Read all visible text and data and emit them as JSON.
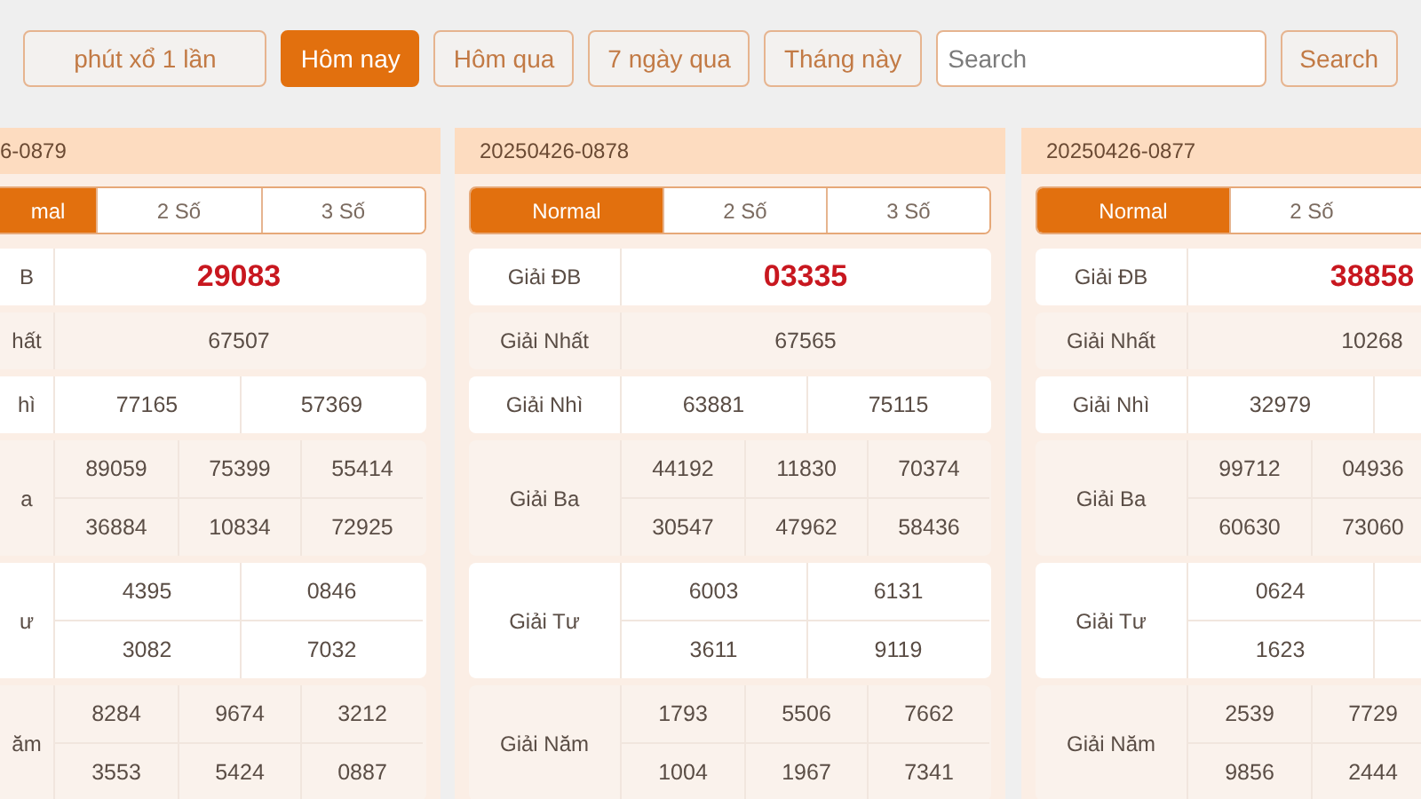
{
  "filters": [
    {
      "label": "phút xổ 1 lần",
      "selected": false
    },
    {
      "label": "Hôm nay",
      "selected": true
    },
    {
      "label": "Hôm qua",
      "selected": false
    },
    {
      "label": "7 ngày qua",
      "selected": false
    },
    {
      "label": "Tháng này",
      "selected": false
    }
  ],
  "search": {
    "placeholder": "Search"
  },
  "search_button": "Search",
  "cards": [
    {
      "kind": "partial_left",
      "id": "6-0879",
      "tabs": [
        {
          "label": "mal",
          "selected": true
        },
        {
          "label": "2 Số",
          "selected": false
        },
        {
          "label": "3 Số",
          "selected": false
        }
      ],
      "prizes": [
        {
          "label": "B",
          "kind": "special",
          "lines": [
            [
              "29083"
            ]
          ]
        },
        {
          "label": "hất",
          "kind": "single",
          "lines": [
            [
              "67507"
            ]
          ]
        },
        {
          "label": "hì",
          "kind": "pair",
          "lines": [
            [
              "77165",
              "57369"
            ]
          ]
        },
        {
          "label": "a",
          "kind": "triple",
          "lines": [
            [
              "89059",
              "75399",
              "55414"
            ],
            [
              "36884",
              "10834",
              "72925"
            ]
          ]
        },
        {
          "label": "ư",
          "kind": "pair",
          "lines": [
            [
              "4395",
              "0846"
            ],
            [
              "3082",
              "7032"
            ]
          ]
        },
        {
          "label": "ăm",
          "kind": "triple",
          "lines": [
            [
              "8284",
              "9674",
              "3212"
            ],
            [
              "3553",
              "5424",
              "0887"
            ]
          ]
        }
      ]
    },
    {
      "kind": "full",
      "id": "20250426-0878",
      "tabs": [
        {
          "label": "Normal",
          "selected": true
        },
        {
          "label": "2 Số",
          "selected": false
        },
        {
          "label": "3 Số",
          "selected": false
        }
      ],
      "prizes": [
        {
          "label": "Giải ĐB",
          "kind": "special",
          "lines": [
            [
              "03335"
            ]
          ]
        },
        {
          "label": "Giải Nhất",
          "kind": "single",
          "lines": [
            [
              "67565"
            ]
          ]
        },
        {
          "label": "Giải Nhì",
          "kind": "pair",
          "lines": [
            [
              "63881",
              "75115"
            ]
          ]
        },
        {
          "label": "Giải Ba",
          "kind": "triple",
          "lines": [
            [
              "44192",
              "11830",
              "70374"
            ],
            [
              "30547",
              "47962",
              "58436"
            ]
          ]
        },
        {
          "label": "Giải Tư",
          "kind": "pair",
          "lines": [
            [
              "6003",
              "6131"
            ],
            [
              "3611",
              "9119"
            ]
          ]
        },
        {
          "label": "Giải Năm",
          "kind": "triple",
          "lines": [
            [
              "1793",
              "5506",
              "7662"
            ],
            [
              "1004",
              "1967",
              "7341"
            ]
          ]
        }
      ]
    },
    {
      "kind": "partial_right",
      "id": "20250426-0877",
      "tabs": [
        {
          "label": "Normal",
          "selected": true
        },
        {
          "label": "2 Số",
          "selected": false
        }
      ],
      "prizes": [
        {
          "label": "Giải ĐB",
          "kind": "special",
          "lines": [
            [
              "38858"
            ]
          ]
        },
        {
          "label": "Giải Nhất",
          "kind": "single",
          "lines": [
            [
              "10268"
            ]
          ]
        },
        {
          "label": "Giải Nhì",
          "kind": "pair",
          "lines": [
            [
              "32979"
            ]
          ]
        },
        {
          "label": "Giải Ba",
          "kind": "triple",
          "lines": [
            [
              "99712",
              "04936"
            ],
            [
              "60630",
              "73060"
            ]
          ]
        },
        {
          "label": "Giải Tư",
          "kind": "pair",
          "lines": [
            [
              "0624"
            ],
            [
              "1623"
            ]
          ]
        },
        {
          "label": "Giải Năm",
          "kind": "triple",
          "lines": [
            [
              "2539",
              "7729"
            ],
            [
              "9856",
              "2444"
            ]
          ]
        }
      ]
    }
  ]
}
